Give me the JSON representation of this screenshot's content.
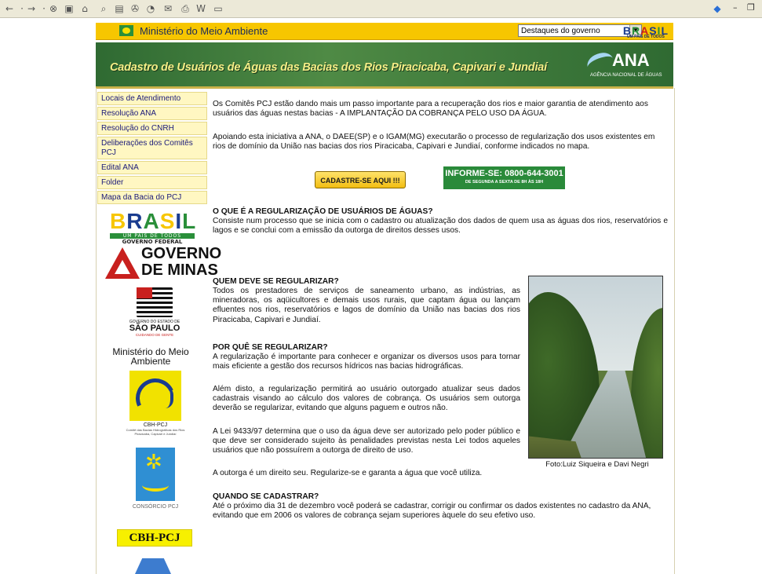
{
  "browser": {
    "toolbar_icons": [
      "back-icon",
      "forward-icon",
      "stop-icon",
      "refresh-icon",
      "home-icon",
      "search-icon",
      "favorites-icon",
      "media-icon",
      "history-icon",
      "mail-icon",
      "print-icon",
      "edit-icon",
      "discuss-icon"
    ],
    "window_controls": [
      "-",
      "̵"
    ]
  },
  "gov_bar": {
    "title": "Ministério do Meio Ambiente",
    "select_value": "Destaques do governo",
    "brasil_logo": "BRASIL",
    "brasil_sub": "UM PAÍS DE TODOS"
  },
  "banner": {
    "title": "Cadastro de Usuários de Águas das Bacias dos Rios Piracicaba, Capivari e Jundiaí",
    "ana_logo": "ANA",
    "ana_sub": "AGÊNCIA NACIONAL DE ÁGUAS"
  },
  "nav": {
    "items": [
      {
        "label": "Locais de Atendimento"
      },
      {
        "label": "Resolução ANA"
      },
      {
        "label": "Resolução do CNRH"
      },
      {
        "label": "Deliberações dos Comitês PCJ"
      },
      {
        "label": "Edital ANA"
      },
      {
        "label": "Folder"
      },
      {
        "label": "Mapa da Bacia do PCJ"
      }
    ]
  },
  "logos": {
    "brasil": {
      "word": "BRASIL",
      "band": "UM PAÍS DE TODOS",
      "caption": "GOVERNO FEDERAL"
    },
    "minas": "GOVERNO DE MINAS",
    "sp": {
      "small": "GOVERNO DO ESTADO DE",
      "big": "SÃO PAULO",
      "tag": "CUIDANDO DE GENTE"
    },
    "mma": "Ministério do Meio Ambiente",
    "cbh": {
      "name": "CBH-PCJ",
      "desc": "Comitê das Bacias Hidrográficas dos Rios Piracicaba, Capivari e Jundiaí"
    },
    "consorcio": "CONSÓRCIO PCJ",
    "cbh_badge": "CBH-PCJ"
  },
  "content": {
    "intro1": "Os Comitês PCJ estão dando mais um passo importante para a recuperação dos rios e maior garantia de atendimento aos usuários das águas nestas bacias - A IMPLANTAÇÃO DA COBRANÇA PELO USO DA ÁGUA.",
    "intro2": "Apoiando esta iniciativa a ANA, o DAEE(SP) e o IGAM(MG) executarão o processo de regularização dos usos existentes em rios de domínio da União nas bacias dos rios Piracicaba, Capivari e Jundiaí, conforme indicados no mapa.",
    "cadastre_button": "CADASTRE-SE AQUI !!!",
    "info_main": "INFORME-SE: 0800-644-3001",
    "info_sub": "DE SEGUNDA A SEXTA DE 8H ÀS 18H",
    "h1": "O QUE É A REGULARIZAÇÃO DE USUÁRIOS DE ÁGUAS?",
    "p1": "Consiste num processo que se inicia com o cadastro ou atualização dos dados de quem usa as águas dos rios, reservatórios e lagos e se conclui com a emissão da outorga de direitos desses usos.",
    "h2": "QUEM DEVE SE REGULARIZAR?",
    "p2": "Todos os prestadores de serviços de saneamento urbano, as indústrias, as mineradoras, os aqüicultores e demais usos rurais, que captam água ou lançam efluentes nos rios, reservatórios e lagos de domínio da União nas bacias dos rios Piracicaba, Capivari e Jundiaí.",
    "h3": "POR QUÊ SE REGULARIZAR?",
    "p3": "A regularização é importante para conhecer e organizar os diversos usos para tornar mais eficiente a gestão dos recursos hídricos nas bacias hidrográficas.",
    "p4": "Além disto, a regularização permitirá ao usuário outorgado atualizar seus dados cadastrais visando ao cálculo dos valores de cobrança. Os usuários sem outorga deverão se regularizar, evitando que alguns paguem e outros não.",
    "p5": "A Lei 9433/97 determina que o uso da água deve ser autorizado pelo poder público e que deve ser considerado sujeito às penalidades previstas nesta Lei todos aqueles usuários que não possuírem a outorga de direito de uso.",
    "p6": "A outorga é um direito seu. Regularize-se e garanta a água que você utiliza.",
    "h4": "QUANDO SE CADASTRAR?",
    "p7": "Até o próximo dia 31 de dezembro você poderá se cadastrar, corrigir ou confirmar os dados existentes no cadastro da ANA, evitando que em 2006 os valores de cobrança sejam superiores àquele do seu efetivo uso.",
    "photo_caption": "Foto:Luiz Siqueira e Davi Negri"
  }
}
